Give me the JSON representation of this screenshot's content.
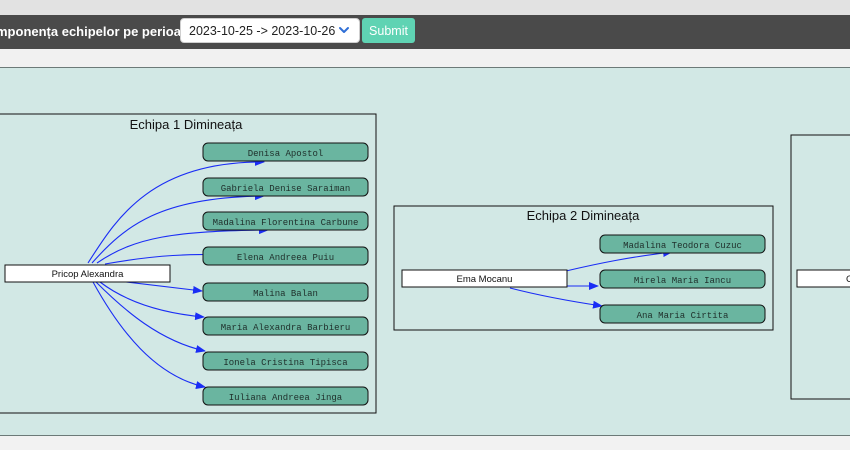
{
  "header": {
    "title": "mponența echipelor pe perioadă",
    "period": "2023-10-25 -> 2023-10-26",
    "submit_label": "Submit"
  },
  "teams": [
    {
      "name": "Echipa 1 Dimineața",
      "lead": "Pricop Alexandra",
      "members": [
        "Denisa Apostol",
        "Gabriela Denise Saraiman",
        "Madalina Florentina Carbune",
        "Elena Andreea Puiu",
        "Malina Balan",
        "Maria Alexandra Barbieru",
        "Ionela Cristina Tipisca",
        "Iuliana Andreea Jinga"
      ]
    },
    {
      "name": "Echipa 2 Dimineața",
      "lead": "Ema Mocanu",
      "members": [
        "Madalina Teodora Cuzuc",
        "Mirela Maria Iancu",
        "Ana Maria Cirtita"
      ]
    },
    {
      "name": "",
      "lead": "C",
      "members": []
    }
  ],
  "colors": {
    "toolbar": "#4a4a4a",
    "canvas": "#d2e8e5",
    "member_fill": "#6ab5a0",
    "edge": "#1a2df5",
    "submit": "#5fd3b3"
  }
}
